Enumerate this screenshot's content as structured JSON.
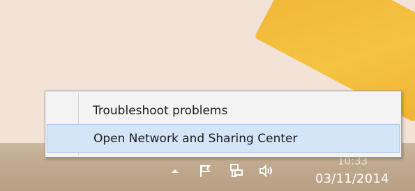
{
  "menu": {
    "items": [
      {
        "label": "Troubleshoot problems",
        "highlighted": false
      },
      {
        "label": "Open Network and Sharing Center",
        "highlighted": true
      }
    ]
  },
  "tray": {
    "icons": [
      {
        "name": "show-hidden-icons"
      },
      {
        "name": "action-center-flag-icon"
      },
      {
        "name": "network-icon"
      },
      {
        "name": "volume-icon"
      }
    ]
  },
  "clock": {
    "time": "10:33",
    "date": "03/11/2014"
  },
  "colors": {
    "menu_highlight": "#d4e5f7",
    "menu_highlight_border": "#a7c7ea",
    "taskbar": "#c2ab91",
    "desktop": "#f3e3d6",
    "accent_orange": "#f2b02b"
  }
}
